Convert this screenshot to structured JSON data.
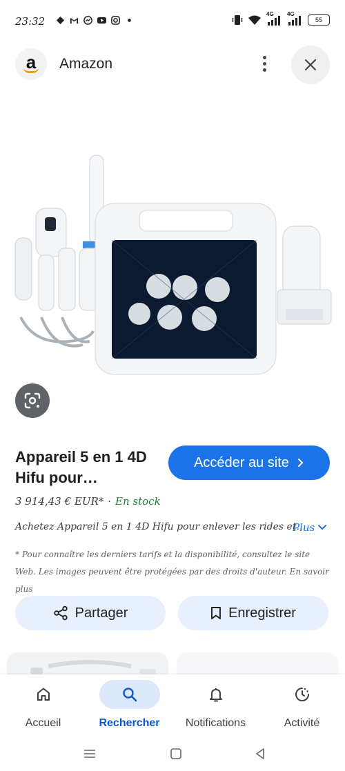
{
  "status_bar": {
    "time": "23:32",
    "network_1": "4G",
    "network_2": "4G",
    "battery": "55"
  },
  "header": {
    "source_name": "Amazon",
    "logo_letter": "a"
  },
  "product": {
    "title": "Appareil 5 en 1 4D Hifu pour…",
    "visit_label": "Accéder au site",
    "price": "3 914,43 € EUR*",
    "separator": "·",
    "stock": "En stock",
    "description": "Achetez Appareil 5 en 1 4D Hifu pour enlever les rides et…",
    "plus_label": "Plus",
    "disclaimer": "* Pour connaître les derniers tarifs et la disponibilité, consultez le site Web. Les images peuvent être protégées par des droits d'auteur. En savoir plus"
  },
  "actions": {
    "share_label": "Partager",
    "save_label": "Enregistrer"
  },
  "bottom_nav": {
    "items": [
      {
        "label": "Accueil",
        "icon": "home-icon"
      },
      {
        "label": "Rechercher",
        "icon": "search-icon"
      },
      {
        "label": "Notifications",
        "icon": "bell-icon"
      },
      {
        "label": "Activité",
        "icon": "activity-icon"
      }
    ]
  },
  "colors": {
    "accent": "#1a73e8",
    "active_nav": "#0b57d0",
    "stock_green": "#188038",
    "action_bg": "#e8f0fe"
  }
}
